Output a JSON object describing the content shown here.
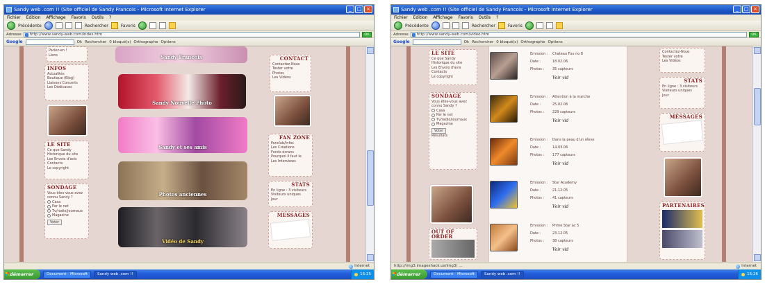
{
  "left": {
    "window_title": "Sandy web .com !! (Site officiel de Sandy Francois - Microsoft Internet Explorer",
    "menu": [
      "Fichier",
      "Edition",
      "Affichage",
      "Favoris",
      "Outils",
      "?"
    ],
    "toolbar": {
      "back": "Précédente",
      "search": "Rechercher",
      "favorites": "Favoris"
    },
    "address_label": "Adresse",
    "address_url": "http://www.sandy-web.com/index.htm",
    "go_label": "OK",
    "google_label": "Google",
    "google_items": [
      "Ok",
      "Rechercher",
      "0 bloqué(s)",
      "Orthographe",
      "Options"
    ],
    "sidebar_left": {
      "block1_lines": [
        "Parlez-en !",
        "Liens"
      ],
      "infos_title": "INFOS",
      "infos_lines": [
        "Actualités",
        "Boutique (Blog)",
        "Liaisons Concerts",
        "Les Dédicaces"
      ],
      "site_title": "LE SITE",
      "site_lines": [
        "Ce que Sandy",
        "Historique du site",
        "Les Envois d'avis",
        "Contacts",
        "Le copyright"
      ],
      "sondage_title": "SONDAGE",
      "sondage_question": "Vous êtes-vous avez connu Sandy ?",
      "sondage_options": [
        "Casa",
        "Par le net",
        "Tv/radio/journaux",
        "Magazine"
      ],
      "vote_label": "Voter"
    },
    "banners": [
      {
        "caption": "Sandy Francois"
      },
      {
        "caption": "Sandy Nouvelle Photo"
      },
      {
        "caption": "Sandy et ses amis"
      },
      {
        "caption": "Photos anciennes"
      },
      {
        "caption": "Vidéo de Sandy"
      }
    ],
    "sidebar_right": {
      "contact_title": "CONTACT",
      "contact_lines": [
        "Contactez-Nous",
        "Tester votre",
        "Photos",
        "Les Vidéos"
      ],
      "fanzone_title": "FAN ZONE",
      "fanzone_lines": [
        "Fanclub/Infos",
        "Les Créations",
        "Fonds écrans",
        "Pourquoi il faut le",
        "Les Interviews"
      ],
      "stats_title": "STATS",
      "stats_lines": [
        "En ligne : 3 visiteurs",
        "Visiteurs uniques",
        "Jour"
      ],
      "messages_title": "MESSAGES"
    },
    "status_text": "",
    "status_zone": "Internet",
    "taskbar": {
      "start": "démarrer",
      "items": [
        "Document - Microsoft",
        "Sandy web .com !!"
      ],
      "clock": "16:25"
    }
  },
  "right": {
    "window_title": "Sandy web .com !! (Site officiel de Sandy Francois - Microsoft Internet Explorer",
    "menu": [
      "Fichier",
      "Edition",
      "Affichage",
      "Favoris",
      "Outils",
      "?"
    ],
    "toolbar": {
      "back": "Précédente",
      "search": "Rechercher",
      "favorites": "Favoris"
    },
    "address_label": "Adresse",
    "address_url": "http://www.sandy-web.com/video.htm",
    "go_label": "OK",
    "google_label": "Google",
    "google_items": [
      "Ok",
      "Rechercher",
      "0 bloqué(s)",
      "Orthographe",
      "Options"
    ],
    "sidebar_left": {
      "site_title": "LE SITE",
      "site_lines": [
        "Ce que Sandy",
        "Historique du site",
        "Les Envois d'avis",
        "Contacts",
        "Le copyright"
      ],
      "sondage_title": "SONDAGE",
      "sondage_question": "Vous êtes-vous avez connu Sandy ?",
      "sondage_options": [
        "Casa",
        "Par le net",
        "Tv/radio/journaux",
        "Magazine"
      ],
      "vote_label": "Voter",
      "results_label": "Résultats",
      "ext_title": "OUT OF ORDER"
    },
    "videos": [
      {
        "emission": "Chateau Fou no 8",
        "date": "18.02.06",
        "vues": "35 capteurs",
        "button": "Voir vid"
      },
      {
        "emission": "Attention à la marche",
        "date": "25.02.06",
        "vues": "229 capteurs",
        "button": "Voir vid"
      },
      {
        "emission": "Dans la peau d'un élève",
        "date": "14.03.06",
        "vues": "177 capteurs",
        "button": "Voir vid"
      },
      {
        "emission": "Star Academy",
        "date": "21.12.05",
        "vues": "41 capteurs",
        "button": "Voir vid"
      },
      {
        "emission": "Prime Star ac 5",
        "date": "23.12.05",
        "vues": "38 capteurs",
        "button": "Voir vid"
      }
    ],
    "video_field_labels": {
      "emission": "Emission :",
      "date": "Date :",
      "vues": "Photos :"
    },
    "sidebar_right": {
      "contact_lines": [
        "Contactez-Nous",
        "Tester votre",
        "Les Vidéos"
      ],
      "stats_title": "STATS",
      "stats_lines": [
        "En ligne : 3 visiteurs",
        "Visiteurs uniques",
        "Jour"
      ],
      "messages_title": "MESSAGES",
      "partners_title": "PARTENAIRES"
    },
    "status_text": "http://img3.imageshack.us/img3/ ...",
    "status_zone": "Internet",
    "taskbar": {
      "start": "démarrer",
      "items": [
        "Document - Microsoft",
        "Sandy web .com !!"
      ],
      "clock": "16:26"
    }
  }
}
